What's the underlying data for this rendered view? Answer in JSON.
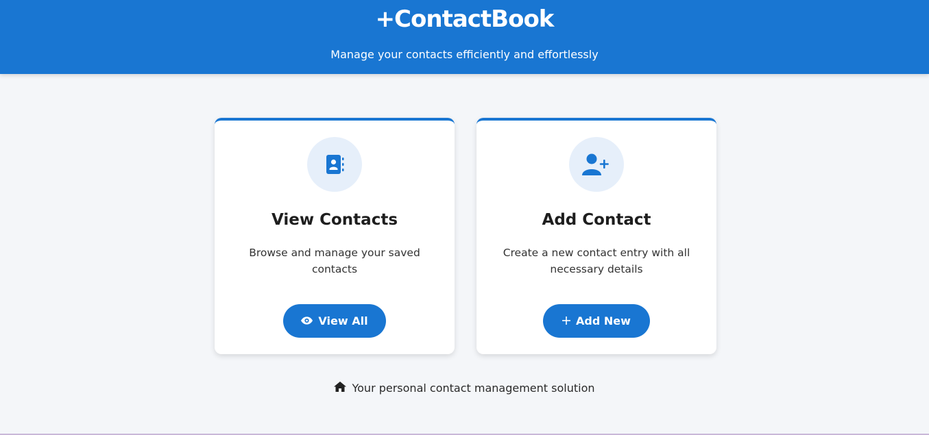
{
  "header": {
    "brand": "+ContactBook",
    "subtitle": "Manage your contacts efficiently and effortlessly"
  },
  "cards": [
    {
      "icon": "address-book-icon",
      "title": "View Contacts",
      "description": "Browse and manage your saved contacts",
      "button_icon": "eye-icon",
      "button_label": "View All"
    },
    {
      "icon": "user-plus-icon",
      "title": "Add Contact",
      "description": "Create a new contact entry with all necessary details",
      "button_icon": "plus-icon",
      "button_label": "Add New"
    }
  ],
  "footer": {
    "icon": "home-icon",
    "text": "Your personal contact management solution"
  },
  "colors": {
    "primary": "#1976d2",
    "icon_bg": "#e6effa",
    "page_bg": "#f4f6f9"
  }
}
